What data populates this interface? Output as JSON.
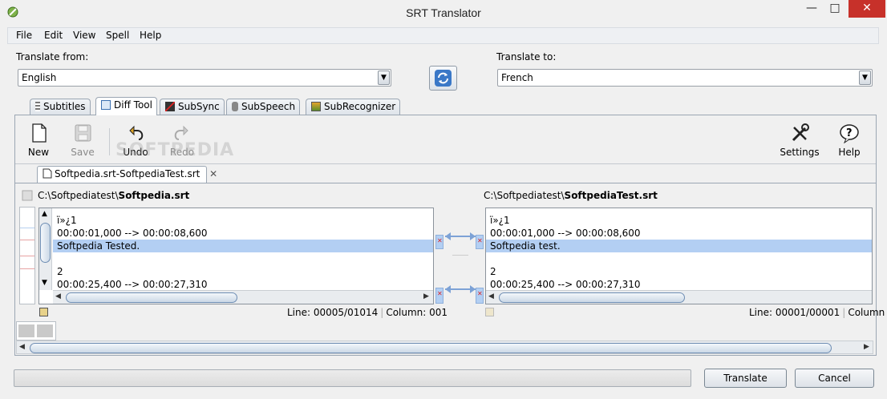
{
  "window": {
    "title": "SRT Translator"
  },
  "menu": [
    "File",
    "Edit",
    "View",
    "Spell",
    "Help"
  ],
  "translate_from": {
    "label": "Translate from:",
    "value": "English"
  },
  "translate_to": {
    "label": "Translate to:",
    "value": "French"
  },
  "tabs": [
    "Subtitles",
    "Diff Tool",
    "SubSync",
    "SubSpeech",
    "SubRecognizer"
  ],
  "toolbar": {
    "new": "New",
    "save": "Save",
    "undo": "Undo",
    "redo": "Redo",
    "settings": "Settings",
    "help": "Help"
  },
  "watermark": "SOFTPEDIA",
  "document_tab": "Softpedia.srt-SoftpediaTest.srt",
  "left": {
    "path_prefix": "C:\\Softpediatest\\",
    "path_file": "Softpedia.srt",
    "lines": [
      "ï»¿1",
      "00:00:01,000 --> 00:00:08,600",
      "Softpedia Tested.",
      "",
      "2",
      "00:00:25,400 --> 00:00:27,310"
    ],
    "status_line": "Line: 00005/01014",
    "status_col": "Column: 001"
  },
  "right": {
    "path_prefix": "C:\\Softpediatest\\",
    "path_file": "SoftpediaTest.srt",
    "lines": [
      "ï»¿1",
      "00:00:01,000 --> 00:00:08,600",
      "Softpedia test.",
      "",
      "2",
      "00:00:25,400 --> 00:00:27,310"
    ],
    "status_line": "Line: 00001/00001",
    "status_col": "Column"
  },
  "buttons": {
    "translate": "Translate",
    "cancel": "Cancel"
  },
  "colors": {
    "highlight": "#b3cff3",
    "close": "#c7312a",
    "accent": "#3a78c7"
  }
}
